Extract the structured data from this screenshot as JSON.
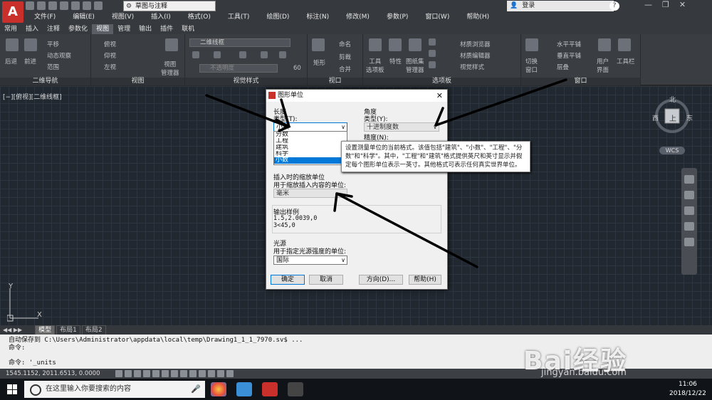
{
  "titlebar": {
    "workspace": "草图与注释",
    "sign_in": "登录",
    "help": "?",
    "min": "—",
    "restore": "❐",
    "close": "✕"
  },
  "menu": [
    "文件(F)",
    "编辑(E)",
    "视图(V)",
    "插入(I)",
    "格式(O)",
    "工具(T)",
    "绘图(D)",
    "标注(N)",
    "修改(M)",
    "参数(P)",
    "窗口(W)",
    "帮助(H)"
  ],
  "ribbon_tabs": [
    "常用",
    "插入",
    "注释",
    "参数化",
    "视图",
    "管理",
    "输出",
    "插件",
    "联机"
  ],
  "ribbon_active_tab": "视图",
  "ribbon": {
    "nav_panel": "二维导航",
    "nav_items": [
      "后退",
      "前进",
      "平移",
      "动态观察",
      "范围"
    ],
    "view_panel": "视图",
    "view_items": [
      "俯视",
      "仰视",
      "左视"
    ],
    "view_manager": "视图\n管理器",
    "style_panel": "视觉样式",
    "style_combo": "二维线框",
    "style_combo2": "不透明度",
    "style_num": "60",
    "viewport_panel": "视口",
    "viewport_items": [
      "矩形",
      "命名",
      "剪裁",
      "合并"
    ],
    "palette_panel": "选项板",
    "palette_items": [
      "工具\n选项板",
      "特性",
      "图纸集\n管理器",
      "材质浏览器",
      "材质编辑器",
      "视觉样式"
    ],
    "window_panel": "窗口",
    "window_items": [
      "切换\n窗口",
      "水平平铺",
      "垂直平铺",
      "层叠",
      "用户\n界面",
      "工具栏"
    ]
  },
  "viewport_label": "[−][俯视][二维线框]",
  "viewcube": {
    "north": "北",
    "south": "南",
    "east": "东",
    "west": "西",
    "face": "上",
    "wcs": "WCS"
  },
  "ucs": {
    "x": "X",
    "y": "Y"
  },
  "layout_tabs": [
    "模型",
    "布局1",
    "布局2"
  ],
  "command": {
    "line1": "自动保存到 C:\\Users\\Administrator\\appdata\\local\\temp\\Drawing1_1_1_7970.sv$ ...",
    "line2": "命令:",
    "prompt": "命令: '_units"
  },
  "status_coords": "1545.1152, 2011.6513, 0.0000",
  "taskbar": {
    "search": "在这里输入你要搜索的内容",
    "time": "11:06",
    "date": "2018/12/22"
  },
  "watermark": "Bai经验",
  "watermark_url": "jingyan.baidu.com",
  "dialog": {
    "title": "图形单位",
    "length_group": "长度",
    "length_type_label": "类型(T):",
    "length_type_value": "小数",
    "length_options": [
      "分数",
      "工程",
      "建筑",
      "科学",
      "小数"
    ],
    "length_selected": "小数",
    "angle_group": "角度",
    "angle_type_label": "类型(Y):",
    "angle_type_value": "十进制度数",
    "angle_precision_label": "精度(N):",
    "tooltip": "设置测量单位的当前格式。该值包括\"建筑\"、\"小数\"、\"工程\"、\"分数\"和\"科学\"。其中，\"工程\"和\"建筑\"格式提供英尺和英寸显示并假定每个图形单位表示一英寸。其他格式可表示任何真实世界单位。",
    "insert_group": "插入时的缩放单位",
    "insert_label": "用于缩放插入内容的单位:",
    "insert_value": "毫米",
    "output_group": "输出样例",
    "output_line1": "1.5,2.0039,0",
    "output_line2": "3<45,0",
    "light_group": "光源",
    "light_label": "用于指定光源强度的单位:",
    "light_value": "国际",
    "btn_ok": "确定",
    "btn_cancel": "取消",
    "btn_direction": "方向(D)...",
    "btn_help": "帮助(H)"
  },
  "colors": {
    "accent": "#0078d7",
    "canvas": "#212830",
    "logo": "#c9302c"
  }
}
